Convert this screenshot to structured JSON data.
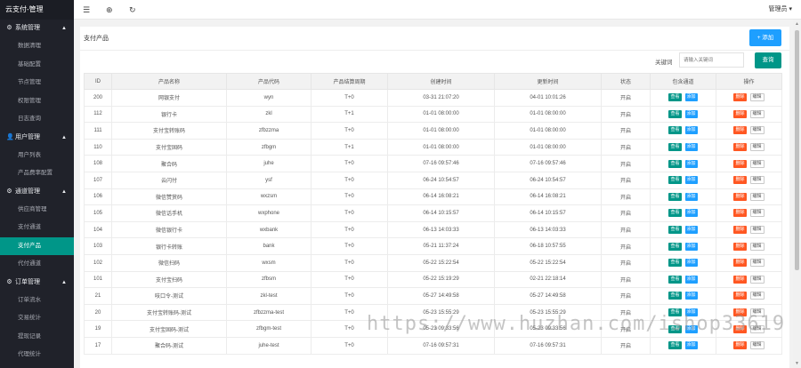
{
  "sidebar": {
    "logo": "云支付-管理",
    "groups": [
      {
        "icon": "⚙",
        "label": "系统管理",
        "items": [
          "数据清理",
          "基础配置",
          "节点管理",
          "权限管理",
          "日志查询"
        ]
      },
      {
        "icon": "👤",
        "label": "用户管理",
        "items": [
          "用户列表",
          "产品费率配置"
        ]
      },
      {
        "icon": "⚙",
        "label": "通道管理",
        "items": [
          "供应商管理",
          "支付通道",
          "支付产品",
          "代付通道"
        ]
      },
      {
        "icon": "⚙",
        "label": "订单管理",
        "items": [
          "订单流水",
          "交易统计",
          "提现记录",
          "代理统计"
        ]
      }
    ],
    "active_item": "支付产品"
  },
  "topbar": {
    "admin_label": "管理员 ▾"
  },
  "page": {
    "title": "支付产品",
    "add_label": "+ 添加",
    "keyword_label": "关键词",
    "keyword_placeholder": "请输入关键词",
    "query_label": "查询"
  },
  "table": {
    "columns": [
      "ID",
      "产品名称",
      "产品代码",
      "产品结算周期",
      "创建时间",
      "更新时间",
      "状态",
      "包含通道",
      "操作"
    ],
    "rows": [
      {
        "id": "200",
        "name": "网银支付",
        "code": "wyn",
        "cycle": "T+0",
        "created": "03-31 21:07:20",
        "updated": "04-01 10:01:26",
        "status": "开启",
        "ch1": "查看",
        "ch2": "添加",
        "op1": "删除",
        "op2": "编辑",
        "ch1_color": "green"
      },
      {
        "id": "112",
        "name": "银行卡",
        "code": "zkl",
        "cycle": "T+1",
        "created": "01-01 08:00:00",
        "updated": "01-01 08:00:00",
        "status": "开启",
        "ch1": "查看",
        "ch2": "添加",
        "op1": "删除",
        "op2": "编辑",
        "ch1_color": "green"
      },
      {
        "id": "111",
        "name": "支付宝转账码",
        "code": "zfbzzma",
        "cycle": "T+0",
        "created": "01-01 08:00:00",
        "updated": "01-01 08:00:00",
        "status": "开启",
        "ch1": "查看",
        "ch2": "添加",
        "op1": "删除",
        "op2": "编辑",
        "ch1_color": "green"
      },
      {
        "id": "110",
        "name": "支付宝固码",
        "code": "zfbgm",
        "cycle": "T+1",
        "created": "01-01 08:00:00",
        "updated": "01-01 08:00:00",
        "status": "开启",
        "ch1": "查看",
        "ch2": "添加",
        "op1": "删除",
        "op2": "编辑",
        "ch1_color": "green"
      },
      {
        "id": "108",
        "name": "聚合码",
        "code": "juhe",
        "cycle": "T+0",
        "created": "07-16 09:57:46",
        "updated": "07-16 09:57:46",
        "status": "开启",
        "ch1": "查看",
        "ch2": "添加",
        "op1": "删除",
        "op2": "编辑",
        "ch1_color": "green"
      },
      {
        "id": "107",
        "name": "云闪付",
        "code": "ysf",
        "cycle": "T+0",
        "created": "06-24 10:54:57",
        "updated": "06-24 10:54:57",
        "status": "开启",
        "ch1": "查看",
        "ch2": "添加",
        "op1": "删除",
        "op2": "编辑",
        "ch1_color": "green"
      },
      {
        "id": "106",
        "name": "微信赞赏码",
        "code": "wxzsm",
        "cycle": "T+0",
        "created": "06-14 16:08:21",
        "updated": "06-14 16:08:21",
        "status": "开启",
        "ch1": "查看",
        "ch2": "添加",
        "op1": "删除",
        "op2": "编辑",
        "ch1_color": "green"
      },
      {
        "id": "105",
        "name": "微信话手机",
        "code": "wxphone",
        "cycle": "T+0",
        "created": "06-14 10:15:57",
        "updated": "06-14 10:15:57",
        "status": "开启",
        "ch1": "查看",
        "ch2": "添加",
        "op1": "删除",
        "op2": "编辑",
        "ch1_color": "green"
      },
      {
        "id": "104",
        "name": "微信银行卡",
        "code": "wxbank",
        "cycle": "T+0",
        "created": "06-13 14:03:33",
        "updated": "06-13 14:03:33",
        "status": "开启",
        "ch1": "查看",
        "ch2": "添加",
        "op1": "删除",
        "op2": "编辑",
        "ch1_color": "green"
      },
      {
        "id": "103",
        "name": "银行卡转账",
        "code": "bank",
        "cycle": "T+0",
        "created": "05-21 11:37:24",
        "updated": "06-18 10:57:55",
        "status": "开启",
        "ch1": "查看",
        "ch2": "添加",
        "op1": "删除",
        "op2": "编辑",
        "ch1_color": "green"
      },
      {
        "id": "102",
        "name": "微信扫码",
        "code": "wxsm",
        "cycle": "T+0",
        "created": "05-22 15:22:54",
        "updated": "05-22 15:22:54",
        "status": "开启",
        "ch1": "查看",
        "ch2": "添加",
        "op1": "删除",
        "op2": "编辑",
        "ch1_color": "green"
      },
      {
        "id": "101",
        "name": "支付宝扫码",
        "code": "zfbsm",
        "cycle": "T+0",
        "created": "05-22 15:19:29",
        "updated": "02-21 22:18:14",
        "status": "开启",
        "ch1": "查看",
        "ch2": "添加",
        "op1": "删除",
        "op2": "编辑",
        "ch1_color": "green"
      },
      {
        "id": "21",
        "name": "吱口令-测试",
        "code": "zkl-test",
        "cycle": "T+0",
        "created": "05-27 14:49:58",
        "updated": "05-27 14:49:58",
        "status": "开启",
        "ch1": "查看",
        "ch2": "添加",
        "op1": "删除",
        "op2": "编辑",
        "ch1_color": "green"
      },
      {
        "id": "20",
        "name": "支付宝转账码-测试",
        "code": "zfbzzma-test",
        "cycle": "T+0",
        "created": "05-23 15:55:29",
        "updated": "05-23 15:55:29",
        "status": "开启",
        "ch1": "查看",
        "ch2": "添加",
        "op1": "删除",
        "op2": "编辑",
        "ch1_color": "green"
      },
      {
        "id": "19",
        "name": "支付宝固码-测试",
        "code": "zfbgm-test",
        "cycle": "T+0",
        "created": "05-23 09:33:56",
        "updated": "05-23 09:33:56",
        "status": "开启",
        "ch1": "查看",
        "ch2": "添加",
        "op1": "删除",
        "op2": "编辑",
        "ch1_color": "green"
      },
      {
        "id": "17",
        "name": "聚合码-测试",
        "code": "juhe-test",
        "cycle": "T+0",
        "created": "07-16 09:57:31",
        "updated": "07-16 09:57:31",
        "status": "开启",
        "ch1": "查看",
        "ch2": "添加",
        "op1": "删除",
        "op2": "编辑",
        "ch1_color": "green"
      }
    ]
  },
  "watermark": "https://www.huzhan.com/ishop33619",
  "colors": {
    "sidebar_bg": "#20222a",
    "active": "#009688",
    "primary": "#1e9fff",
    "danger": "#ff5722"
  }
}
